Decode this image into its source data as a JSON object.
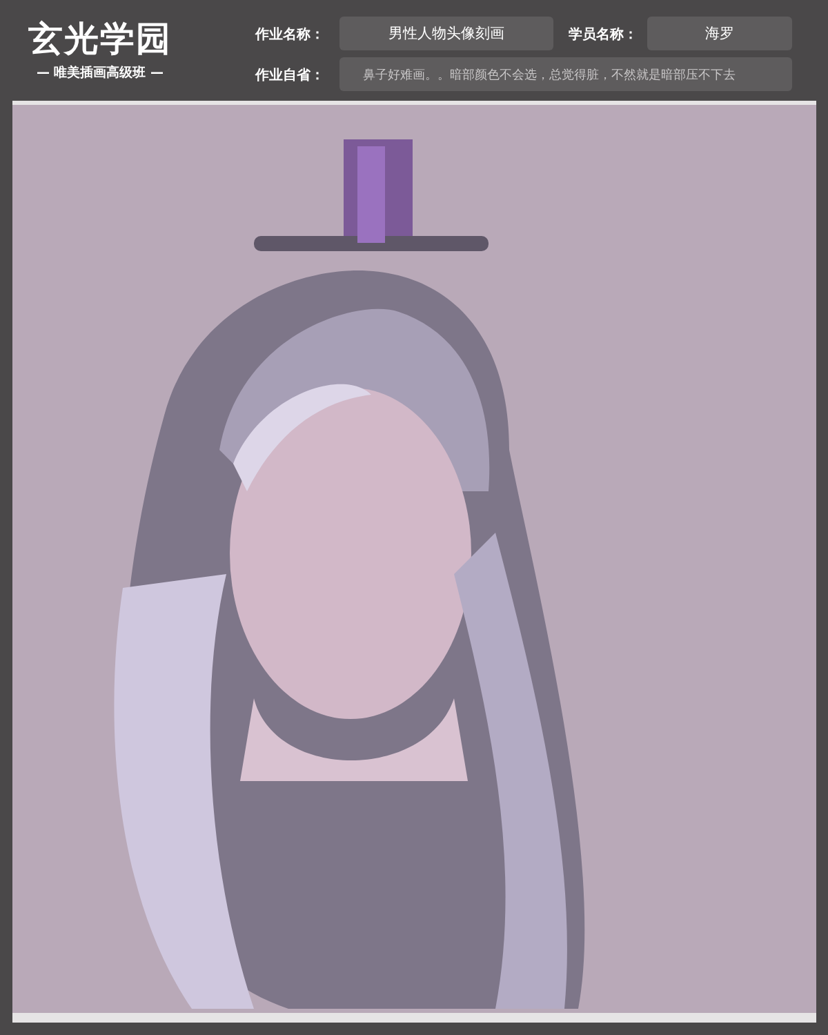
{
  "brand": {
    "logo": "玄光学园",
    "tagline": "— 唯美插画高级班 —"
  },
  "fields": [
    {
      "label": "作业名称：",
      "value": "男性人物头像刻画"
    },
    {
      "label": "学员名称：",
      "value": "海罗"
    },
    {
      "label": "作业自省：",
      "value": "鼻子好难画。。暗部颜色不会选，总觉得脏，不然就是暗部压不下去"
    }
  ]
}
